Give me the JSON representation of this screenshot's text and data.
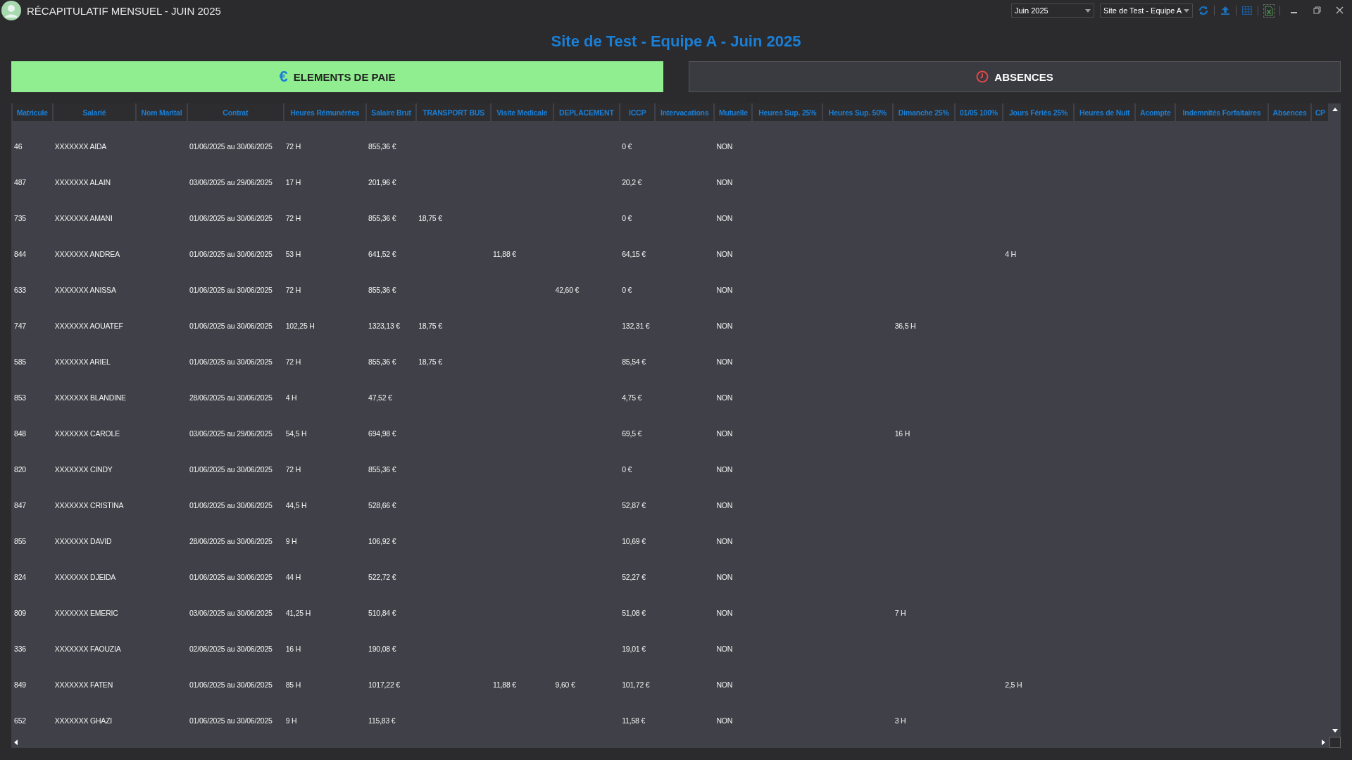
{
  "window": {
    "title": "RÉCAPITULATIF MENSUEL - JUIN 2025"
  },
  "toolbar": {
    "period": "Juin 2025",
    "site": "Site de Test - Equipe A"
  },
  "heading": "Site de Test - Equipe A - Juin 2025",
  "tabs": [
    {
      "label": "ELEMENTS DE PAIE",
      "kind": "glyph",
      "glyph": "€",
      "selected": true
    },
    {
      "label": "ABSENCES",
      "kind": "clock",
      "selected": false
    }
  ],
  "table": {
    "columns": [
      "Matricule",
      "Salarié",
      "Nom Marital",
      "Contrat",
      "Heures Rémunérées",
      "Salaire Brut",
      "TRANSPORT BUS",
      "Visite Medicale",
      "DEPLACEMENT",
      "ICCP",
      "Intervacations",
      "Mutuelle",
      "Heures Sup. 25%",
      "Heures Sup. 50%",
      "Dimanche 25%",
      "01/05 100%",
      "Jours Fériés 25%",
      "Heures de Nuit",
      "Acompte",
      "Indemnités Forfaitaires",
      "Absences",
      "CP"
    ],
    "rows": [
      {
        "matricule": "46",
        "salarie": "XXXXXXX AIDA",
        "contrat": "01/06/2025 au 30/06/2025",
        "heures": "72 H",
        "brut": "855,36 €",
        "iccp": "0 €",
        "mutuelle": "NON"
      },
      {
        "matricule": "487",
        "salarie": "XXXXXXX ALAIN",
        "contrat": "03/06/2025 au 29/06/2025",
        "heures": "17 H",
        "brut": "201,96 €",
        "iccp": "20,2 €",
        "mutuelle": "NON"
      },
      {
        "matricule": "735",
        "salarie": "XXXXXXX AMANI",
        "contrat": "01/06/2025 au 30/06/2025",
        "heures": "72 H",
        "brut": "855,36 €",
        "transport": "18,75 €",
        "iccp": "0 €",
        "mutuelle": "NON"
      },
      {
        "matricule": "844",
        "salarie": "XXXXXXX ANDREA",
        "contrat": "01/06/2025 au 30/06/2025",
        "heures": "53 H",
        "brut": "641,52 €",
        "visite": "11,88 €",
        "iccp": "64,15 €",
        "mutuelle": "NON",
        "feries": "4 H"
      },
      {
        "matricule": "633",
        "salarie": "XXXXXXX ANISSA",
        "contrat": "01/06/2025 au 30/06/2025",
        "heures": "72 H",
        "brut": "855,36 €",
        "deplacement": "42,60 €",
        "iccp": "0 €",
        "mutuelle": "NON"
      },
      {
        "matricule": "747",
        "salarie": "XXXXXXX AOUATEF",
        "contrat": "01/06/2025 au 30/06/2025",
        "heures": "102,25 H",
        "brut": "1323,13 €",
        "transport": "18,75 €",
        "iccp": "132,31 €",
        "mutuelle": "NON",
        "dimanche": "36,5 H"
      },
      {
        "matricule": "585",
        "salarie": "XXXXXXX ARIEL",
        "contrat": "01/06/2025 au 30/06/2025",
        "heures": "72 H",
        "brut": "855,36 €",
        "transport": "18,75 €",
        "iccp": "85,54 €",
        "mutuelle": "NON"
      },
      {
        "matricule": "853",
        "salarie": "XXXXXXX BLANDINE",
        "contrat": "28/06/2025 au 30/06/2025",
        "heures": "4 H",
        "brut": "47,52 €",
        "iccp": "4,75 €",
        "mutuelle": "NON"
      },
      {
        "matricule": "848",
        "salarie": "XXXXXXX CAROLE",
        "contrat": "03/06/2025 au 29/06/2025",
        "heures": "54,5 H",
        "brut": "694,98 €",
        "iccp": "69,5 €",
        "mutuelle": "NON",
        "dimanche": "16 H"
      },
      {
        "matricule": "820",
        "salarie": "XXXXXXX CINDY",
        "contrat": "01/06/2025 au 30/06/2025",
        "heures": "72 H",
        "brut": "855,36 €",
        "iccp": "0 €",
        "mutuelle": "NON"
      },
      {
        "matricule": "847",
        "salarie": "XXXXXXX CRISTINA",
        "contrat": "01/06/2025 au 30/06/2025",
        "heures": "44,5 H",
        "brut": "528,66 €",
        "iccp": "52,87 €",
        "mutuelle": "NON"
      },
      {
        "matricule": "855",
        "salarie": "XXXXXXX DAVID",
        "contrat": "28/06/2025 au 30/06/2025",
        "heures": "9 H",
        "brut": "106,92 €",
        "iccp": "10,69 €",
        "mutuelle": "NON"
      },
      {
        "matricule": "824",
        "salarie": "XXXXXXX DJEIDA",
        "contrat": "01/06/2025 au 30/06/2025",
        "heures": "44 H",
        "brut": "522,72 €",
        "iccp": "52,27 €",
        "mutuelle": "NON"
      },
      {
        "matricule": "809",
        "salarie": "XXXXXXX EMERIC",
        "contrat": "03/06/2025 au 30/06/2025",
        "heures": "41,25 H",
        "brut": "510,84 €",
        "iccp": "51,08 €",
        "mutuelle": "NON",
        "dimanche": "7 H"
      },
      {
        "matricule": "336",
        "salarie": "XXXXXXX FAOUZIA",
        "contrat": "02/06/2025 au 30/06/2025",
        "heures": "16 H",
        "brut": "190,08 €",
        "iccp": "19,01 €",
        "mutuelle": "NON"
      },
      {
        "matricule": "849",
        "salarie": "XXXXXXX FATEN",
        "contrat": "01/06/2025 au 30/06/2025",
        "heures": "85 H",
        "brut": "1017,22 €",
        "visite": "11,88 €",
        "deplacement": "9,60 €",
        "iccp": "101,72 €",
        "mutuelle": "NON",
        "feries": "2,5 H"
      },
      {
        "matricule": "652",
        "salarie": "XXXXXXX GHAZI",
        "contrat": "01/06/2025 au 30/06/2025",
        "heures": "9 H",
        "brut": "115,83 €",
        "iccp": "11,58 €",
        "mutuelle": "NON",
        "dimanche": "3 H"
      }
    ]
  }
}
